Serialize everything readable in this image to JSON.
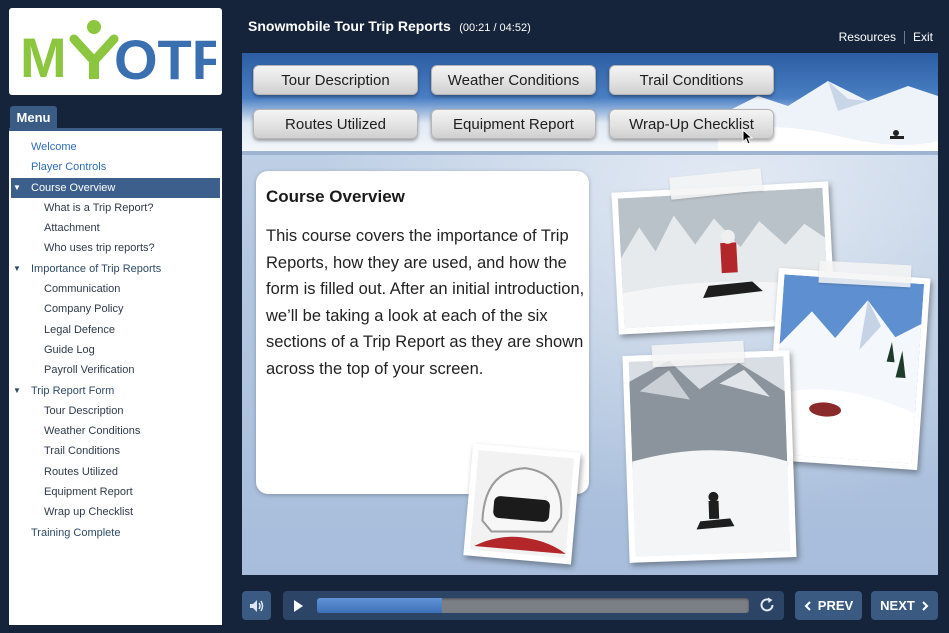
{
  "logo": {
    "text": "MYOTF"
  },
  "menu": {
    "tab_label": "Menu",
    "items": [
      {
        "label": "Welcome",
        "level": 0,
        "link": true
      },
      {
        "label": "Player Controls",
        "level": 0,
        "link": true
      },
      {
        "label": "Course Overview",
        "level": 0,
        "expandable": true,
        "active": true
      },
      {
        "label": "What is a Trip Report?",
        "level": 1
      },
      {
        "label": "Attachment",
        "level": 1
      },
      {
        "label": "Who uses trip reports?",
        "level": 1
      },
      {
        "label": "Importance of Trip Reports",
        "level": 0,
        "expandable": true
      },
      {
        "label": "Communication",
        "level": 1
      },
      {
        "label": "Company Policy",
        "level": 1
      },
      {
        "label": "Legal Defence",
        "level": 1
      },
      {
        "label": "Guide Log",
        "level": 1
      },
      {
        "label": "Payroll Verification",
        "level": 1
      },
      {
        "label": "Trip Report Form",
        "level": 0,
        "expandable": true
      },
      {
        "label": "Tour Description",
        "level": 1
      },
      {
        "label": "Weather Conditions",
        "level": 1
      },
      {
        "label": "Trail Conditions",
        "level": 1
      },
      {
        "label": "Routes Utilized",
        "level": 1
      },
      {
        "label": "Equipment Report",
        "level": 1
      },
      {
        "label": "Wrap up Checklist",
        "level": 1
      },
      {
        "label": "Training Complete",
        "level": 0
      }
    ]
  },
  "header": {
    "title": "Snowmobile Tour Trip Reports",
    "timer": "(00:21 / 04:52)",
    "resources_label": "Resources",
    "exit_label": "Exit"
  },
  "slide": {
    "nav_buttons": [
      "Tour Description",
      "Weather Conditions",
      "Trail Conditions",
      "Routes Utilized",
      "Equipment Report",
      "Wrap-Up Checklist"
    ],
    "card_title": "Course Overview",
    "card_body": "This course covers the importance of Trip Reports, how they are used, and how the form is filled out. After an initial introduction, we’ll be taking a look at each of the six sections of a Trip Report as they are shown across the top of your screen."
  },
  "player": {
    "progress_fraction": 0.29,
    "prev_label": "PREV",
    "next_label": "NEXT"
  },
  "colors": {
    "background": "#15243a",
    "menu_accent": "#3a5b83",
    "progress_fill": "#4a7fc4",
    "logo_green": "#8cc63f",
    "logo_blue": "#3a6fb0"
  }
}
